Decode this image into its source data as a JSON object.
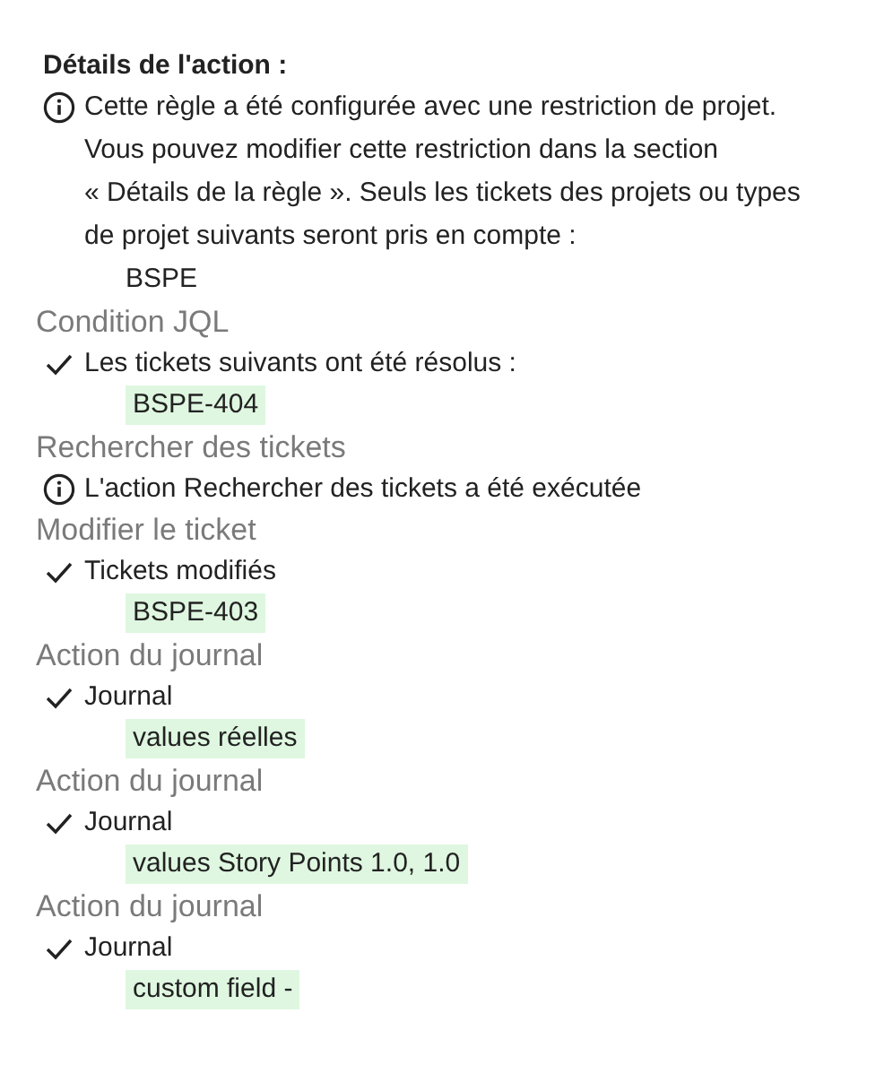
{
  "title": "Détails de l'action :",
  "restriction": {
    "text": "Cette règle a été configurée avec une restriction de projet. Vous pouvez modifier cette restriction dans la section « Détails de la règle ». Seuls les tickets des projets ou types de projet suivants seront pris en compte :",
    "projects": [
      "BSPE"
    ]
  },
  "sections": [
    {
      "title": "Condition JQL",
      "entries": [
        {
          "kind": "check",
          "text": "Les tickets suivants ont été résolus :",
          "tags": [
            "BSPE-404"
          ]
        }
      ]
    },
    {
      "title": "Rechercher des tickets",
      "entries": [
        {
          "kind": "info",
          "text": "L'action Rechercher des tickets a été exécutée"
        }
      ]
    },
    {
      "title": "Modifier le ticket",
      "entries": [
        {
          "kind": "check",
          "text": "Tickets modifiés",
          "tags": [
            "BSPE-403"
          ]
        }
      ]
    },
    {
      "title": "Action du journal",
      "entries": [
        {
          "kind": "check",
          "text": "Journal",
          "tags": [
            "values réelles"
          ]
        }
      ]
    },
    {
      "title": "Action du journal",
      "entries": [
        {
          "kind": "check",
          "text": "Journal",
          "tags": [
            "values Story Points 1.0, 1.0"
          ]
        }
      ]
    },
    {
      "title": "Action du journal",
      "entries": [
        {
          "kind": "check",
          "text": "Journal",
          "tags": [
            "custom field -"
          ]
        }
      ]
    }
  ]
}
